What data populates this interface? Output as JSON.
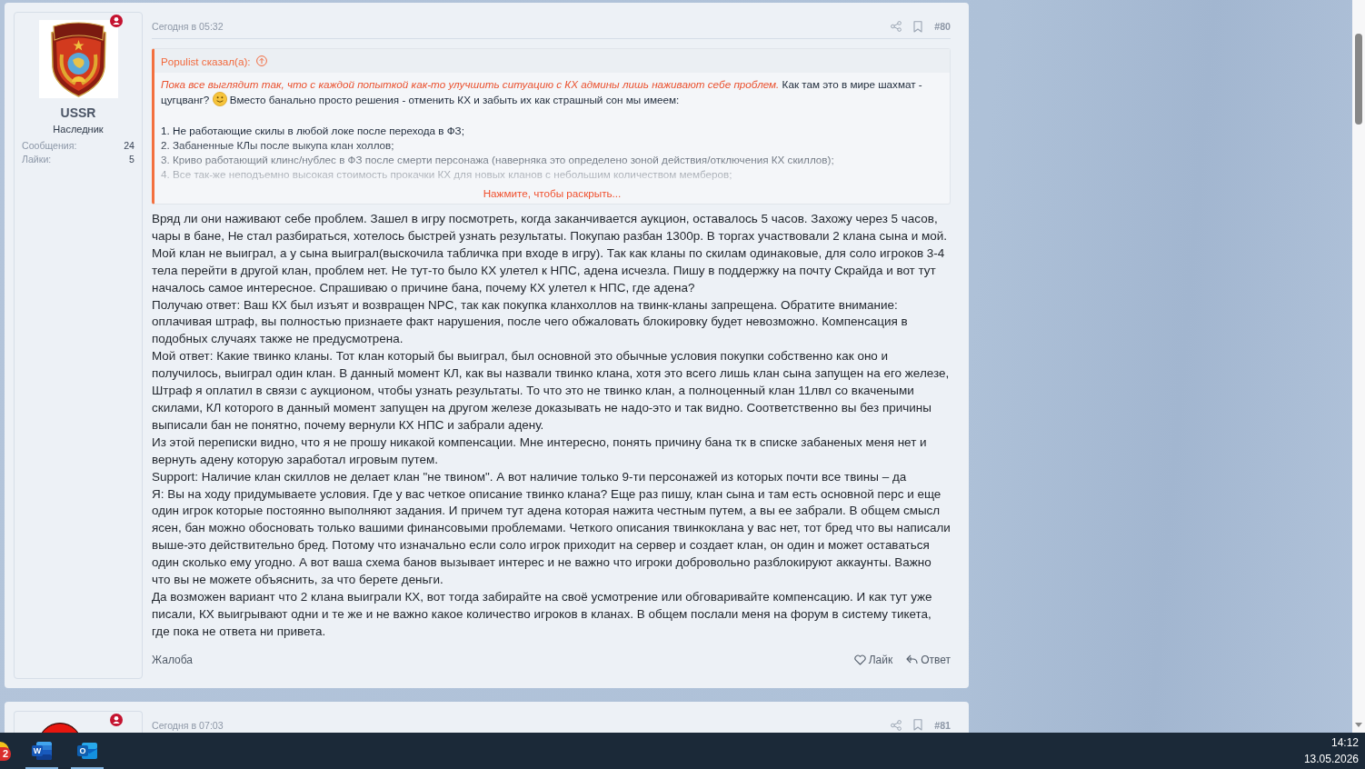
{
  "posts": [
    {
      "author": {
        "avatar": {
          "kind": "emblem"
        },
        "name": "USSR",
        "title": "Наследник",
        "stats": [
          {
            "label": "Сообщения:",
            "value": "24"
          },
          {
            "label": "Лайки:",
            "value": "5"
          }
        ]
      },
      "time": "Сегодня в 05:32",
      "number": "#80",
      "quote": {
        "author": "Populist сказал(а):",
        "expanded": false,
        "intro": [
          "*Пока все выглядит так, что с каждой попыткой как-то улучшить ситуацию с КХ админы лишь наживают себе проблем.* Как там это в мире шахмат - цугцванг?",
          "Вместо банально просто решения - отменить КХ и забыть их как страшный сон мы имеем:"
        ],
        "items": [
          "1. Не работающие скилы в любой локе после перехода в ФЗ;",
          "2. Забаненные КЛы после выкупа клан холлов;",
          "3. Криво работающий клинс/нублес в ФЗ после смерти персонажа (наверняка это определено зоной действия/отключения КХ скиллов);",
          "4. Все так-же неподъемно высокая стоимость прокачки КХ для новых кланов с небольшим количеством мемберов;"
        ],
        "expand": "Нажмите, чтобы раскрыть..."
      },
      "paragraphs": [
        "Вряд ли они наживают себе проблем. Зашел в игру посмотреть, когда заканчивается аукцион, оставалось 5 часов. Захожу через 5 часов, чары в бане, Не стал разбираться, хотелось быстрей узнать результаты. Покупаю разбан 1300р. В торгах участвовали 2 клана сына и мой. Мой клан не выиграл, а у сына выиграл(выскочила табличка при входе в игру). Так как кланы по скилам одинаковые, для соло игроков 3-4 тела перейти в другой клан, проблем нет. Не тут-то было КХ улетел к НПС, адена исчезла. Пишу в поддержку на почту Скрайда и вот тут началось самое интересное. Спрашиваю о причине бана, почему КХ улетел к НПС, где адена?",
        "Получаю ответ: Ваш КХ был изъят и возвращен NPC, так как покупка кланхоллов на твинк-кланы запрещена. Обратите внимание: оплачивая штраф, вы полностью признаете факт нарушения, после чего обжаловать блокировку будет невозможно. Компенсация в подобных случаях также не предусмотрена.",
        "Мой ответ: Какие твинко кланы. Тот клан который бы выиграл, был основной это обычные условия покупки собственно как оно и получилось, выиграл один клан. В данный момент КЛ, как вы назвали твинко клана, хотя это всего лишь клан сына запущен на его железе, Штраф я оплатил в связи с аукционом, чтобы узнать результаты. То что это не твинко клан, а полноценный клан 11лвл со вкачеными скилами, КЛ которого в данный момент запущен на другом железе доказывать не надо-это и так видно. Соответственно вы без причины выписали бан не понятно, почему вернули КХ НПС и забрали адену.",
        "Из этой переписки видно, что я не прошу никакой компенсации. Мне интересно, понять причину бана тк в списке забаненых меня нет и вернуть адену которую заработал игровым путем.",
        "Support: Наличие клан скиллов не делает клан \"не твином\". А вот наличие только 9-ти персонажей из которых почти все твины – да",
        "Я: Вы на ходу придумываете условия. Где у вас четкое описание твинко клана? Еще раз пишу, клан сына и там есть основной перс и еще один игрок которые постоянно выполняют задания. И причем тут адена которая нажита честным путем, а вы ее забрали. В общем смысл ясен, бан можно обосновать только вашими финансовыми проблемами. Четкого описания твинкоклана у вас нет, тот бред что вы написали выше-это действительно бред. Потому что изначально если соло игрок приходит на сервер и создает клан, он один и может оставаться один сколько ему угодно. А вот ваша схема банов вызывает интерес и не важно что игроки добровольно разблокируют аккаунты. Важно что вы не можете объяснить, за что берете деньги.",
        "Да возможен вариант что 2 клана выиграли КХ, вот тогда забирайте на своё усмотрение или обговаривайте компенсацию. И как тут уже писали, КХ выигрывают одни и те же и не важно какое количество игроков в кланах. В общем послали меня на форум в систему тикета, где пока не ответа ни привета."
      ],
      "actions": {
        "report": "Жалоба",
        "like": "Лайк",
        "reply": "Ответ"
      }
    },
    {
      "author": {
        "avatar": {
          "kind": "circle"
        }
      },
      "time": "Сегодня в 07:03",
      "number": "#81"
    }
  ],
  "taskbar": {
    "apps": [
      {
        "kind": "round",
        "badge": "2",
        "running": false
      },
      {
        "kind": "document",
        "letter": "W",
        "running": true
      },
      {
        "kind": "mail",
        "letter": "O",
        "running": true
      }
    ],
    "time": "14:12",
    "date": "13.05.2026"
  }
}
